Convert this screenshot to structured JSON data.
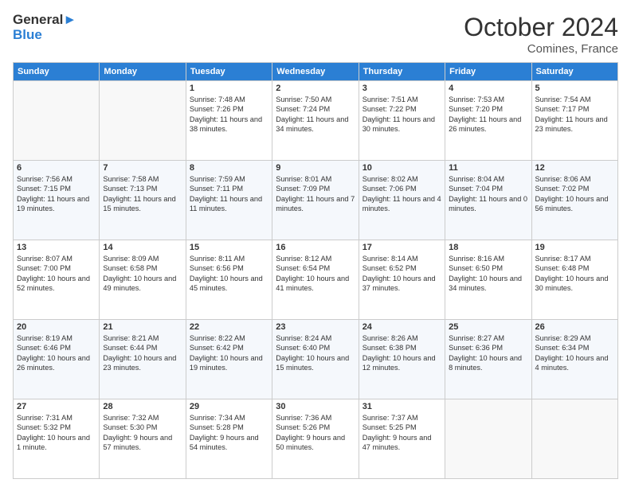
{
  "header": {
    "logo_general": "General",
    "logo_blue": "Blue",
    "month_year": "October 2024",
    "location": "Comines, France"
  },
  "days_of_week": [
    "Sunday",
    "Monday",
    "Tuesday",
    "Wednesday",
    "Thursday",
    "Friday",
    "Saturday"
  ],
  "weeks": [
    {
      "days": [
        {
          "num": "",
          "info": ""
        },
        {
          "num": "",
          "info": ""
        },
        {
          "num": "1",
          "info": "Sunrise: 7:48 AM\nSunset: 7:26 PM\nDaylight: 11 hours and 38 minutes."
        },
        {
          "num": "2",
          "info": "Sunrise: 7:50 AM\nSunset: 7:24 PM\nDaylight: 11 hours and 34 minutes."
        },
        {
          "num": "3",
          "info": "Sunrise: 7:51 AM\nSunset: 7:22 PM\nDaylight: 11 hours and 30 minutes."
        },
        {
          "num": "4",
          "info": "Sunrise: 7:53 AM\nSunset: 7:20 PM\nDaylight: 11 hours and 26 minutes."
        },
        {
          "num": "5",
          "info": "Sunrise: 7:54 AM\nSunset: 7:17 PM\nDaylight: 11 hours and 23 minutes."
        }
      ]
    },
    {
      "days": [
        {
          "num": "6",
          "info": "Sunrise: 7:56 AM\nSunset: 7:15 PM\nDaylight: 11 hours and 19 minutes."
        },
        {
          "num": "7",
          "info": "Sunrise: 7:58 AM\nSunset: 7:13 PM\nDaylight: 11 hours and 15 minutes."
        },
        {
          "num": "8",
          "info": "Sunrise: 7:59 AM\nSunset: 7:11 PM\nDaylight: 11 hours and 11 minutes."
        },
        {
          "num": "9",
          "info": "Sunrise: 8:01 AM\nSunset: 7:09 PM\nDaylight: 11 hours and 7 minutes."
        },
        {
          "num": "10",
          "info": "Sunrise: 8:02 AM\nSunset: 7:06 PM\nDaylight: 11 hours and 4 minutes."
        },
        {
          "num": "11",
          "info": "Sunrise: 8:04 AM\nSunset: 7:04 PM\nDaylight: 11 hours and 0 minutes."
        },
        {
          "num": "12",
          "info": "Sunrise: 8:06 AM\nSunset: 7:02 PM\nDaylight: 10 hours and 56 minutes."
        }
      ]
    },
    {
      "days": [
        {
          "num": "13",
          "info": "Sunrise: 8:07 AM\nSunset: 7:00 PM\nDaylight: 10 hours and 52 minutes."
        },
        {
          "num": "14",
          "info": "Sunrise: 8:09 AM\nSunset: 6:58 PM\nDaylight: 10 hours and 49 minutes."
        },
        {
          "num": "15",
          "info": "Sunrise: 8:11 AM\nSunset: 6:56 PM\nDaylight: 10 hours and 45 minutes."
        },
        {
          "num": "16",
          "info": "Sunrise: 8:12 AM\nSunset: 6:54 PM\nDaylight: 10 hours and 41 minutes."
        },
        {
          "num": "17",
          "info": "Sunrise: 8:14 AM\nSunset: 6:52 PM\nDaylight: 10 hours and 37 minutes."
        },
        {
          "num": "18",
          "info": "Sunrise: 8:16 AM\nSunset: 6:50 PM\nDaylight: 10 hours and 34 minutes."
        },
        {
          "num": "19",
          "info": "Sunrise: 8:17 AM\nSunset: 6:48 PM\nDaylight: 10 hours and 30 minutes."
        }
      ]
    },
    {
      "days": [
        {
          "num": "20",
          "info": "Sunrise: 8:19 AM\nSunset: 6:46 PM\nDaylight: 10 hours and 26 minutes."
        },
        {
          "num": "21",
          "info": "Sunrise: 8:21 AM\nSunset: 6:44 PM\nDaylight: 10 hours and 23 minutes."
        },
        {
          "num": "22",
          "info": "Sunrise: 8:22 AM\nSunset: 6:42 PM\nDaylight: 10 hours and 19 minutes."
        },
        {
          "num": "23",
          "info": "Sunrise: 8:24 AM\nSunset: 6:40 PM\nDaylight: 10 hours and 15 minutes."
        },
        {
          "num": "24",
          "info": "Sunrise: 8:26 AM\nSunset: 6:38 PM\nDaylight: 10 hours and 12 minutes."
        },
        {
          "num": "25",
          "info": "Sunrise: 8:27 AM\nSunset: 6:36 PM\nDaylight: 10 hours and 8 minutes."
        },
        {
          "num": "26",
          "info": "Sunrise: 8:29 AM\nSunset: 6:34 PM\nDaylight: 10 hours and 4 minutes."
        }
      ]
    },
    {
      "days": [
        {
          "num": "27",
          "info": "Sunrise: 7:31 AM\nSunset: 5:32 PM\nDaylight: 10 hours and 1 minute."
        },
        {
          "num": "28",
          "info": "Sunrise: 7:32 AM\nSunset: 5:30 PM\nDaylight: 9 hours and 57 minutes."
        },
        {
          "num": "29",
          "info": "Sunrise: 7:34 AM\nSunset: 5:28 PM\nDaylight: 9 hours and 54 minutes."
        },
        {
          "num": "30",
          "info": "Sunrise: 7:36 AM\nSunset: 5:26 PM\nDaylight: 9 hours and 50 minutes."
        },
        {
          "num": "31",
          "info": "Sunrise: 7:37 AM\nSunset: 5:25 PM\nDaylight: 9 hours and 47 minutes."
        },
        {
          "num": "",
          "info": ""
        },
        {
          "num": "",
          "info": ""
        }
      ]
    }
  ]
}
